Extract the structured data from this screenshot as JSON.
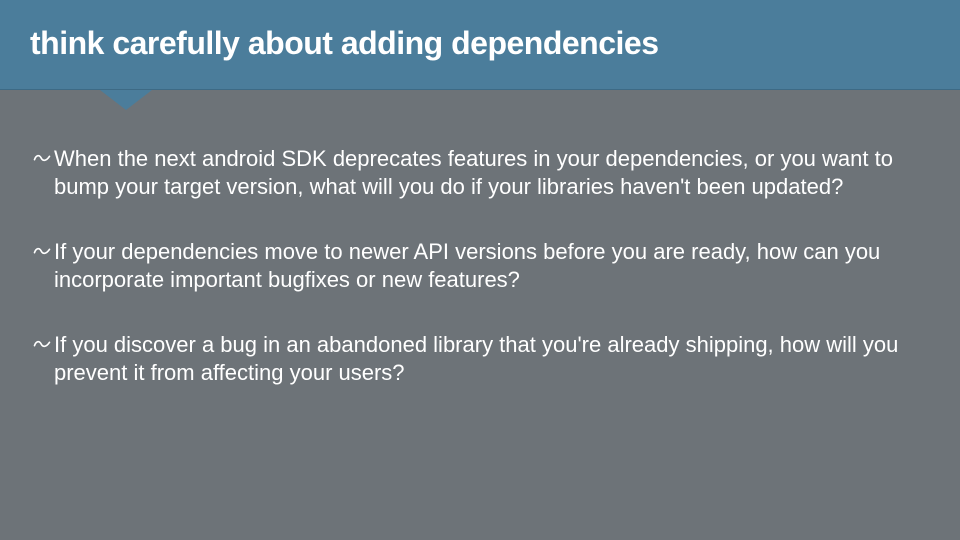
{
  "slide": {
    "title": "think carefully about adding dependencies",
    "bullets": [
      "When the next android SDK deprecates features in your dependencies, or you want to bump your target version, what will you do if your libraries haven't been updated?",
      "If your dependencies move to newer API versions before you are ready, how can you incorporate important bugfixes or new features?",
      "If you discover a bug in an abandoned library that you're already shipping, how will you prevent it from affecting your users?"
    ]
  },
  "colors": {
    "header_bg": "#4b7d9b",
    "body_bg": "#6d7378",
    "text": "#ffffff"
  }
}
